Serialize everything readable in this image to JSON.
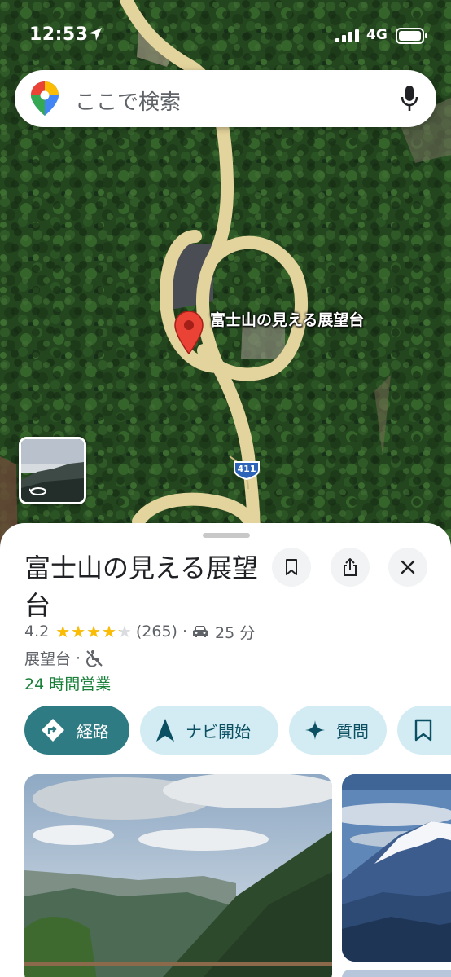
{
  "status_bar": {
    "time": "12:53",
    "network": "4G"
  },
  "search": {
    "placeholder": "ここで検索"
  },
  "map": {
    "place_label": "富士山の見える展望台",
    "route_number": "411"
  },
  "place": {
    "name": "富士山の見える展望台",
    "rating": "4.2",
    "rating_value": 4.2,
    "review_count": "(265)",
    "separator": "·",
    "drive_time": "25 分",
    "category": "展望台",
    "hours": "24 時間営業"
  },
  "actions": [
    {
      "label": "経路",
      "icon": "directions-icon"
    },
    {
      "label": "ナビ開始",
      "icon": "navigation-arrow-icon"
    },
    {
      "label": "質問",
      "icon": "sparkle-icon"
    }
  ],
  "colors": {
    "primary_chip": "#2f7b84",
    "secondary_chip": "#d3ecf3",
    "open_hours": "#188038",
    "star": "#fbbc04"
  }
}
